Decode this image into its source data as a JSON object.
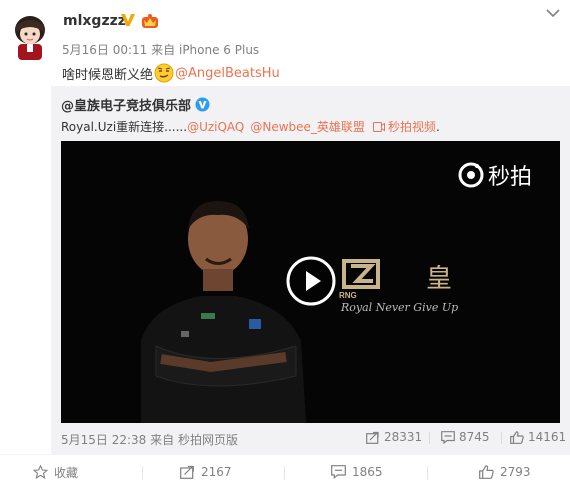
{
  "post": {
    "username": "mlxgzzz",
    "time": "5月16日 00:11",
    "source_prefix": "来自",
    "source": "iPhone 6 Plus",
    "text": "啥时候恩断义绝",
    "mention": "@AngelBeatsHu"
  },
  "repost": {
    "author": "@皇族电子竞技俱乐部",
    "text": "Royal.Uzi重新连接......",
    "mention1": "@UziQAQ",
    "mention2": "@Newbee_英雄联盟",
    "video_link": "秒拍视频",
    "trail": ".",
    "time": "5月15日 22:38",
    "source_prefix": "来自",
    "source": "秒拍网页版",
    "forwards": "28331",
    "comments": "8745",
    "likes": "14161",
    "video": {
      "watermark": "秒拍",
      "team_mark": "RNG",
      "team_char": "皇",
      "slogan": "Royal Never Give Up"
    }
  },
  "actions": {
    "favorite": "收藏",
    "forwards": "2167",
    "comments": "1865",
    "likes": "2793"
  },
  "colors": {
    "link": "#eb7350",
    "muted": "#808080",
    "repost_bg": "#f2f2f5",
    "verified": "#f7a500"
  }
}
